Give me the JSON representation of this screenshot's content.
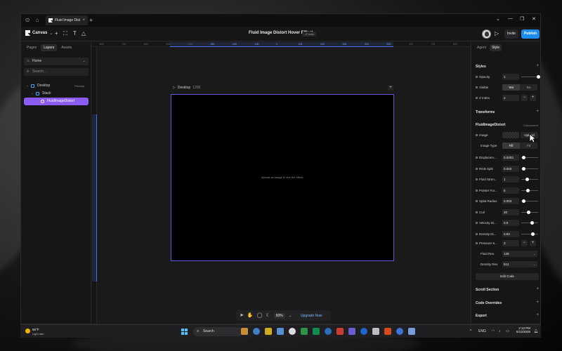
{
  "browser": {
    "tab_title": "Fluid Image Distor...",
    "tab_close": "×",
    "new_tab": "+",
    "min": "—",
    "restore": "❐",
    "close": "✕",
    "chevron": "⌄"
  },
  "toolbar": {
    "menu_label": "Canvas",
    "menu_chevron": "⌄",
    "title": "Fluid Image Distort Hover Effect",
    "badge": "⎇ main",
    "invite": "Invite",
    "publish": "Publish"
  },
  "left": {
    "tabs": [
      "Pages",
      "Layers",
      "Assets"
    ],
    "active_tab": "Layers",
    "page_select": "Home",
    "search_placeholder": "Search...",
    "layers": [
      {
        "label": "Desktop",
        "tag": "Primary"
      },
      {
        "label": "Stack",
        "tag": ""
      },
      {
        "label": "FluidImageDistort",
        "tag": ""
      }
    ]
  },
  "canvas": {
    "ruler_ticks": [
      "-800",
      "-700",
      "-600",
      "-500",
      "-400",
      "-300",
      "-200",
      "-100",
      "0",
      "100",
      "200",
      "300",
      "400",
      "500",
      "600",
      "700",
      "800"
    ],
    "frame_name": "Desktop",
    "frame_width": "1200",
    "frame_add": "+",
    "hint": "Upload an image to see the effect.",
    "zoom": "60%",
    "zoom_chevron": "⌄",
    "upgrade": "Upgrade Now"
  },
  "right": {
    "tabs": [
      "Agent",
      "Style"
    ],
    "active_tab": "Style",
    "styles_title": "Styles",
    "opacity_label": "Opacity",
    "opacity_value": "1",
    "opacity_level": 1.0,
    "visible_label": "Visible",
    "visible_yes": "Yes",
    "visible_no": "No",
    "zindex_label": "Z Index",
    "zindex_value": "2",
    "transforms_title": "Transforms",
    "component_title": "FluidImageDistort",
    "component_tag": "Component",
    "image_label": "Image",
    "upload_label": "Upload",
    "image_type_label": "Image Type",
    "image_type_fill": "Fill",
    "image_type_fit": "Fit",
    "props": [
      {
        "label": "Displacem...",
        "value": "0.0003",
        "level": 0.15
      },
      {
        "label": "RGB Split",
        "value": "0.003",
        "level": 0.15
      },
      {
        "label": "Fluid Stren...",
        "value": "1",
        "level": 0.35
      },
      {
        "label": "Pointer For...",
        "value": "5",
        "level": 0.4
      },
      {
        "label": "Splat Radius",
        "value": "0.003",
        "level": 0.15
      },
      {
        "label": "Curl",
        "value": "20",
        "level": 0.45
      },
      {
        "label": "Velocity Di...",
        "value": "0.9",
        "level": 0.65
      },
      {
        "label": "Density Di...",
        "value": "0.93",
        "level": 0.7
      }
    ],
    "pressure_label": "Pressure S...",
    "pressure_value": "3",
    "fluid_res_label": "Fluid Res.",
    "fluid_res_value": "128",
    "density_res_label": "Density Res.",
    "density_res_value": "512",
    "edit_code": "Edit Code",
    "scroll_section": "Scroll Section",
    "code_overrides": "Code Overrides",
    "export": "Export",
    "plus": "+",
    "minus": "−",
    "chevron": "⌄"
  },
  "taskbar": {
    "temp": "56°F",
    "weather": "Light rain",
    "search": "Search",
    "lang": "ENG",
    "time": "2:13 PM",
    "date": "6/13/2026",
    "chevron": "^",
    "app_colors": [
      "#e6a23c",
      "#4a90e2",
      "#f0c419",
      "#5ea5f0",
      "#ffffff",
      "#34a853",
      "#0f9d58",
      "#2b7cd3",
      "#ea4335",
      "#7b68ee",
      "#1f6feb",
      "#d9d9d9",
      "#f4511e",
      "#4285f4",
      "#8ab4f8"
    ]
  },
  "colors": {
    "accent": "#8b5cf6",
    "publish": "#1d8cf0",
    "frame_border": "#5b5bd6",
    "upgrade": "#7db7ff"
  }
}
